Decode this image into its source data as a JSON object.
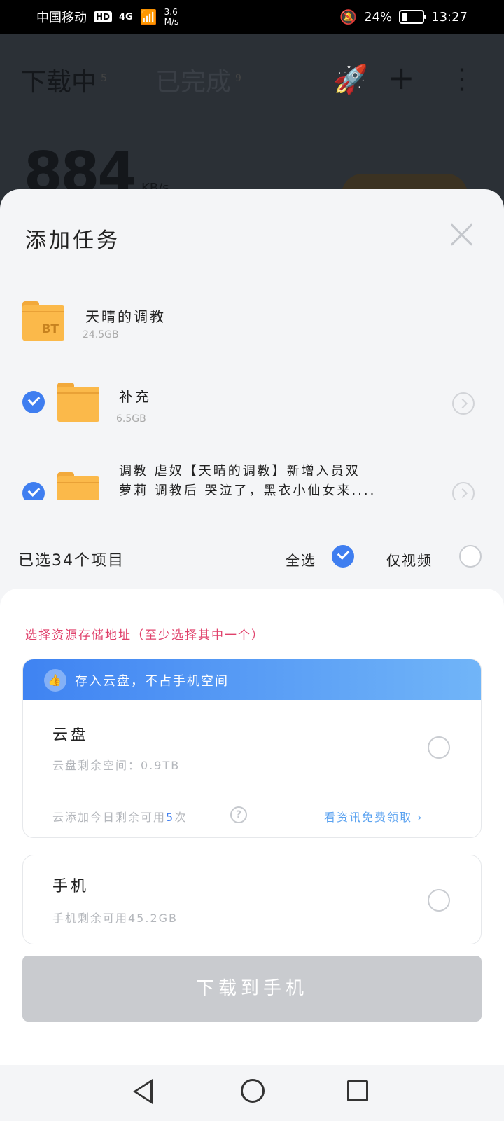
{
  "status_bar": {
    "carrier": "中国移动",
    "hd": "HD",
    "signal": "4G",
    "speed_value": "3.6",
    "speed_unit": "M/s",
    "battery": "24%",
    "time": "13:27"
  },
  "background_app": {
    "tab_downloading": "下载中",
    "tab_downloading_count": "5",
    "tab_completed": "已完成",
    "tab_completed_count": "9",
    "speed_value": "884",
    "speed_unit": "KB/s"
  },
  "sheet": {
    "title": "添加任务",
    "files": [
      {
        "name": "天晴的调教",
        "size": "24.5GB",
        "type": "BT"
      },
      {
        "name": "补充",
        "size": "6.5GB"
      },
      {
        "name_line1": "调教 虐奴【天晴的调教】新增入员双",
        "name_line2": "萝莉 调教后 哭泣了，黑衣小仙女来...."
      }
    ],
    "selected_count": "已选34个项目",
    "select_all_label": "全选",
    "video_only_label": "仅视频"
  },
  "storage": {
    "hint": "选择资源存储地址（至少选择其中一个）",
    "cloud_banner": "存入云盘，不占手机空间",
    "cloud_title": "云盘",
    "cloud_space": "云盘剩余空间：0.9TB",
    "cloud_today_prefix": "云添加今日剩余可用",
    "cloud_today_count": "5",
    "cloud_today_suffix": "次",
    "free_link": "看资讯免费领取",
    "phone_title": "手机",
    "phone_space": "手机剩余可用45.2GB",
    "download_button": "下载到手机"
  },
  "colors": {
    "accent_blue": "#3f7ef0",
    "hint_red": "#e0416b",
    "folder_yellow": "#fbb94a",
    "disabled_button": "#c9cbcf"
  }
}
